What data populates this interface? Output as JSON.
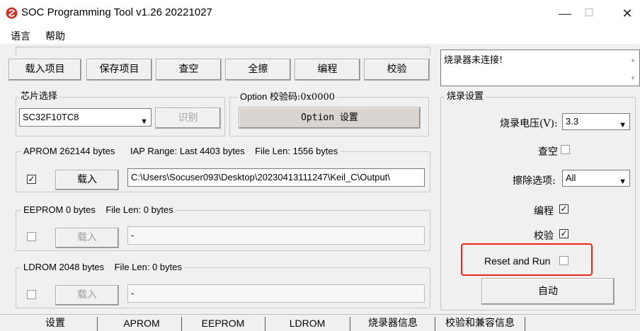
{
  "window": {
    "title": "SOC Programming Tool v1.26 20221027",
    "minimize": "—",
    "maximize": "☐",
    "close": "✕"
  },
  "menu": {
    "language": "语言",
    "help": "帮助"
  },
  "toolbar": {
    "load_project": "载入项目",
    "save_project": "保存项目",
    "check_blank": "查空",
    "erase_all": "全擦",
    "program": "编程",
    "verify": "校验"
  },
  "chip_select": {
    "legend": "芯片选择",
    "selected": "SC32F10TC8",
    "identify": "识别"
  },
  "option": {
    "legend_prefix": "Option",
    "legend_suffix": "校验码:0x0000",
    "settings_button": "Option 设置"
  },
  "aprom": {
    "header": "APROM 262144 bytes      IAP Range: Last 4403 bytes    File Len: 1556 bytes",
    "checked": "✓",
    "load": "载入",
    "path": "C:\\Users\\Socuser093\\Desktop\\20230413111247\\Keil_C\\Output\\"
  },
  "eeprom": {
    "header": "EEPROM 0 bytes    File Len: 0 bytes",
    "load": "载入",
    "path": "-"
  },
  "ldrom": {
    "header": "LDROM 2048 bytes    File Len: 0 bytes",
    "load": "载入",
    "path": "-"
  },
  "status": {
    "text": "烧录器未连接!"
  },
  "burn_settings": {
    "legend": "烧录设置",
    "voltage_label": "烧录电压(V):",
    "voltage_value": "3.3",
    "check_blank_label": "查空",
    "erase_option_label": "擦除选项:",
    "erase_option_value": "All",
    "program_label": "编程",
    "program_checked": "✓",
    "verify_label": "校验",
    "verify_checked": "✓",
    "reset_run_label": "Reset and Run",
    "auto_button": "自动"
  },
  "tabs": [
    "设置",
    "APROM",
    "EEPROM",
    "LDROM",
    "烧录器信息",
    "校验和兼容信息"
  ],
  "colors": {
    "highlight_box": "#e8261c",
    "app_icon": "#d0302a"
  }
}
